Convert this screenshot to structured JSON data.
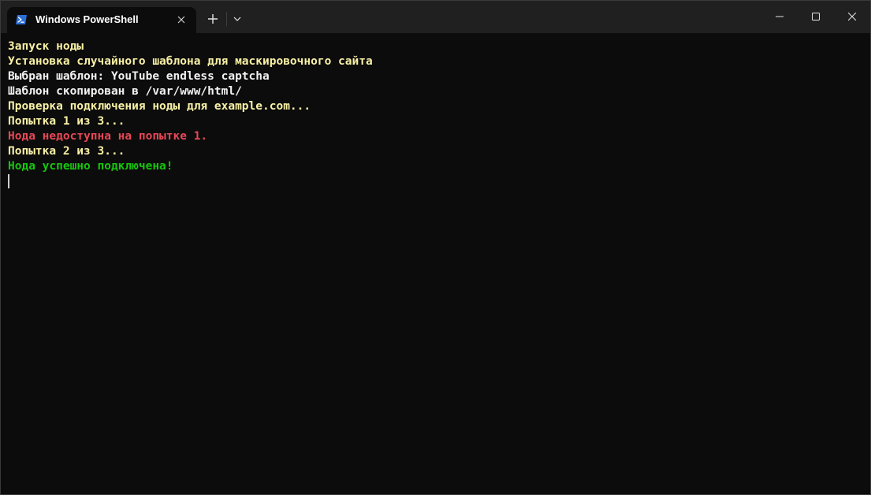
{
  "window": {
    "tab_title": "Windows PowerShell",
    "tab_icon": "powershell-icon",
    "new_tab_label": "+",
    "colors": {
      "titlebar": "#202020",
      "terminal_bg": "#0c0c0c",
      "icon_blue": "#2b6fd6"
    }
  },
  "terminal": {
    "lines": [
      {
        "text": "Запуск ноды",
        "color": "#f9f1a5"
      },
      {
        "text": "Установка случайного шаблона для маскировочного сайта",
        "color": "#f9f1a5"
      },
      {
        "text": "Выбран шаблон: YouTube endless captcha",
        "color": "#f2f2f2"
      },
      {
        "text": "Шаблон скопирован в /var/www/html/",
        "color": "#f2f2f2"
      },
      {
        "text": "Проверка подключения ноды для example.com...",
        "color": "#f9f1a5"
      },
      {
        "text": "Попытка 1 из 3...",
        "color": "#f9f1a5"
      },
      {
        "text": "Нода недоступна на попытке 1.",
        "color": "#e74856"
      },
      {
        "text": "Попытка 2 из 3...",
        "color": "#f9f1a5"
      },
      {
        "text": "Нода успешно подключена!",
        "color": "#16c60c"
      }
    ]
  }
}
